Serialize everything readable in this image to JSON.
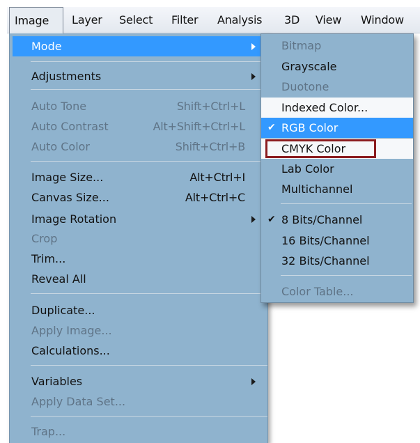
{
  "menubar": {
    "items": [
      "Image",
      "Layer",
      "Select",
      "Filter",
      "Analysis",
      "3D",
      "View",
      "Window"
    ]
  },
  "image_menu": {
    "items": [
      {
        "label": "Mode",
        "shortcut": "",
        "submenu": true,
        "state": "highlighted"
      },
      {
        "label": "Adjustments",
        "shortcut": "",
        "submenu": true,
        "state": "enabled"
      },
      {
        "label": "Auto Tone",
        "shortcut": "Shift+Ctrl+L",
        "submenu": false,
        "state": "disabled"
      },
      {
        "label": "Auto Contrast",
        "shortcut": "Alt+Shift+Ctrl+L",
        "submenu": false,
        "state": "disabled"
      },
      {
        "label": "Auto Color",
        "shortcut": "Shift+Ctrl+B",
        "submenu": false,
        "state": "disabled"
      },
      {
        "label": "Image Size...",
        "shortcut": "Alt+Ctrl+I",
        "submenu": false,
        "state": "enabled"
      },
      {
        "label": "Canvas Size...",
        "shortcut": "Alt+Ctrl+C",
        "submenu": false,
        "state": "enabled"
      },
      {
        "label": "Image Rotation",
        "shortcut": "",
        "submenu": true,
        "state": "enabled"
      },
      {
        "label": "Crop",
        "shortcut": "",
        "submenu": false,
        "state": "disabled"
      },
      {
        "label": "Trim...",
        "shortcut": "",
        "submenu": false,
        "state": "enabled"
      },
      {
        "label": "Reveal All",
        "shortcut": "",
        "submenu": false,
        "state": "enabled"
      },
      {
        "label": "Duplicate...",
        "shortcut": "",
        "submenu": false,
        "state": "enabled"
      },
      {
        "label": "Apply Image...",
        "shortcut": "",
        "submenu": false,
        "state": "disabled"
      },
      {
        "label": "Calculations...",
        "shortcut": "",
        "submenu": false,
        "state": "enabled"
      },
      {
        "label": "Variables",
        "shortcut": "",
        "submenu": true,
        "state": "enabled"
      },
      {
        "label": "Apply Data Set...",
        "shortcut": "",
        "submenu": false,
        "state": "disabled"
      },
      {
        "label": "Trap...",
        "shortcut": "",
        "submenu": false,
        "state": "disabled"
      }
    ]
  },
  "mode_submenu": {
    "items": [
      {
        "label": "Bitmap",
        "checked": false,
        "state": "disabled"
      },
      {
        "label": "Grayscale",
        "checked": false,
        "state": "enabled"
      },
      {
        "label": "Duotone",
        "checked": false,
        "state": "disabled"
      },
      {
        "label": "Indexed Color...",
        "checked": false,
        "state": "enabled"
      },
      {
        "label": "RGB Color",
        "checked": true,
        "state": "highlighted"
      },
      {
        "label": "CMYK Color",
        "checked": false,
        "state": "outlined"
      },
      {
        "label": "Lab Color",
        "checked": false,
        "state": "enabled"
      },
      {
        "label": "Multichannel",
        "checked": false,
        "state": "enabled"
      },
      {
        "label": "8 Bits/Channel",
        "checked": true,
        "state": "enabled"
      },
      {
        "label": "16 Bits/Channel",
        "checked": false,
        "state": "enabled"
      },
      {
        "label": "32 Bits/Channel",
        "checked": false,
        "state": "enabled"
      },
      {
        "label": "Color Table...",
        "checked": false,
        "state": "disabled"
      }
    ],
    "check_glyph": "✔"
  },
  "colors": {
    "menu_bg": "#8fb3ce",
    "highlight": "#3399ff",
    "outline": "#8b1c1f"
  }
}
